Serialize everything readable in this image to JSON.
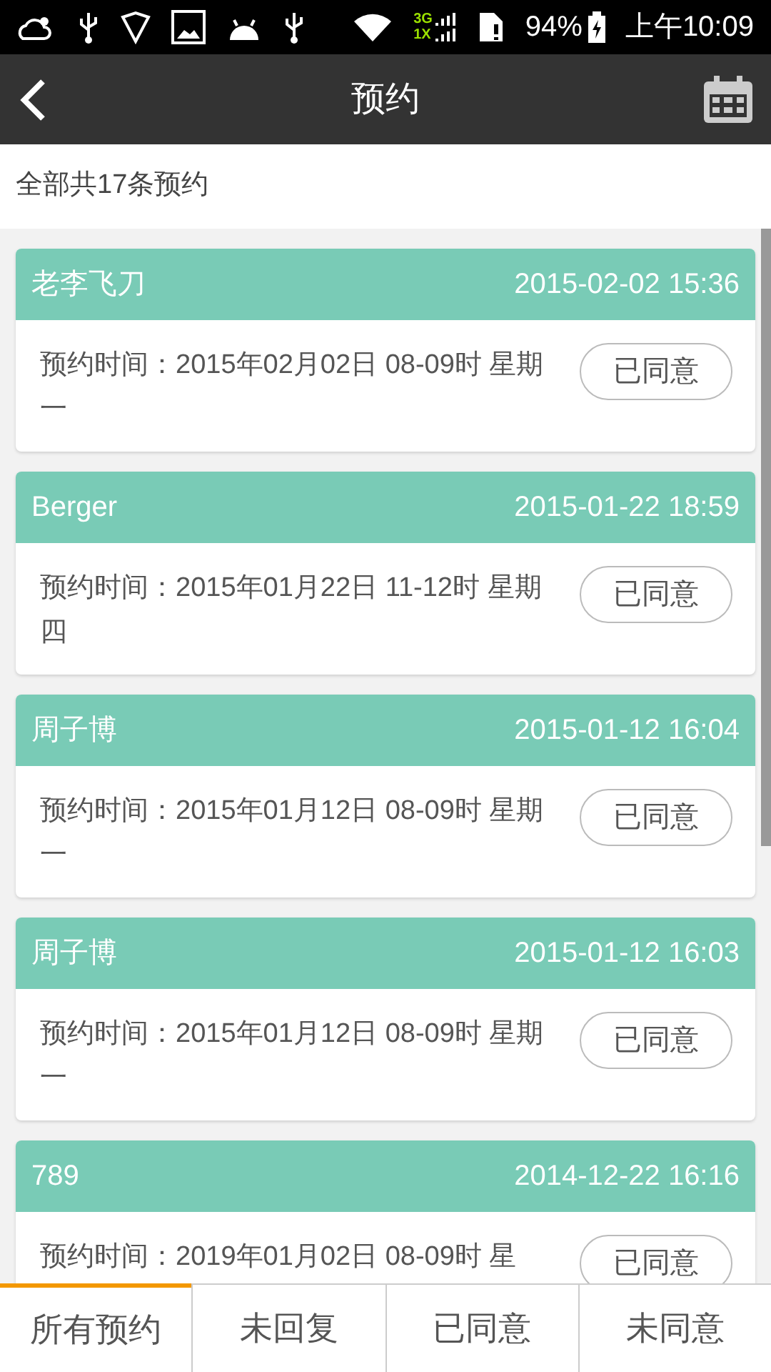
{
  "status_bar": {
    "network_top": "3G",
    "network_bottom": "1X",
    "battery": "94%",
    "time": "上午10:09"
  },
  "header": {
    "title": "预约"
  },
  "summary": "全部共17条预约",
  "appointments": [
    {
      "name": "老李飞刀",
      "created": "2015-02-02 15:36",
      "detail": "预约时间：2015年02月02日 08-09时 星期一",
      "status": "已同意"
    },
    {
      "name": "Berger",
      "created": "2015-01-22 18:59",
      "detail": "预约时间：2015年01月22日 11-12时 星期四",
      "status": "已同意"
    },
    {
      "name": "周子博",
      "created": "2015-01-12 16:04",
      "detail": "预约时间：2015年01月12日 08-09时 星期一",
      "status": "已同意"
    },
    {
      "name": "周子博",
      "created": "2015-01-12 16:03",
      "detail": "预约时间：2015年01月12日 08-09时 星期一",
      "status": "已同意"
    },
    {
      "name": "789",
      "created": "2014-12-22 16:16",
      "detail": "预约时间：2019年01月02日 08-09时 星",
      "status": "已同意"
    }
  ],
  "tabs": [
    {
      "label": "所有预约",
      "selected": true
    },
    {
      "label": "未回复",
      "selected": false
    },
    {
      "label": "已同意",
      "selected": false
    },
    {
      "label": "未同意",
      "selected": false
    }
  ]
}
